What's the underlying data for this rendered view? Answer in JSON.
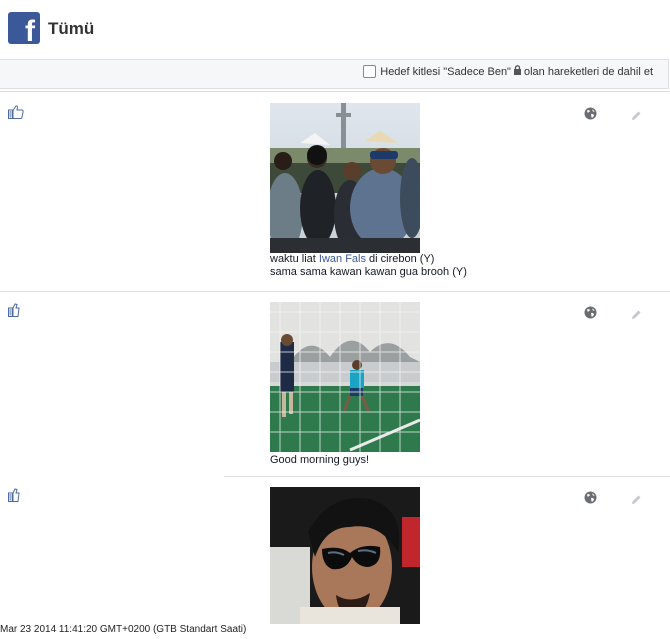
{
  "header": {
    "logo_letter": "f",
    "title": "Tümü"
  },
  "filter": {
    "label_before": "Hedef kitlesi \"Sadece Ben\"",
    "label_after": "olan hareketleri de dahil et",
    "checked": false
  },
  "entries": [
    {
      "caption_line1_pre": "waktu liat ",
      "caption_line1_link": "Iwan Fals",
      "caption_line1_post": " di cirebon (Y)",
      "caption_line2": "sama sama kawan kawan gua brooh (Y)",
      "privacy": "public-globe-icon"
    },
    {
      "caption_line1": "Good morning guys!",
      "privacy": "public-globe-icon"
    },
    {
      "privacy": "public-globe-icon"
    }
  ],
  "status_bar": "Mar 23 2014 11:41:20 GMT+0200 (GTB Standart Saati)",
  "colors": {
    "brand": "#3b5998",
    "link": "#3b5998",
    "border": "#dddfe2"
  }
}
